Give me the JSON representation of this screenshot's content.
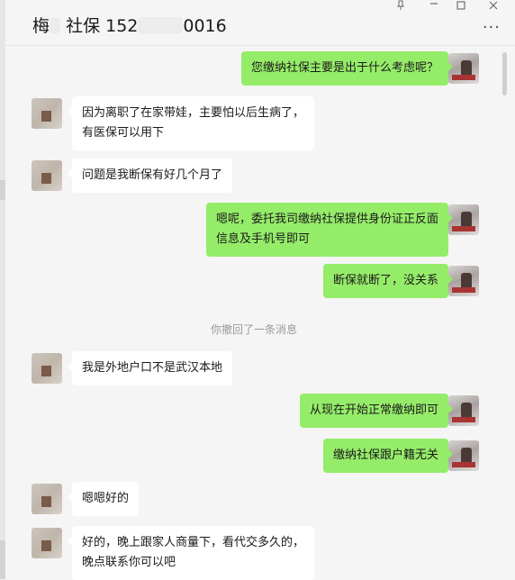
{
  "header": {
    "title_prefix": "梅",
    "title_mid": "社保 152",
    "title_suffix": "0016",
    "pin_icon": "pin-icon",
    "minimize_icon": "minimize-icon",
    "maximize_icon": "maximize-icon",
    "close_icon": "close-icon",
    "more_icon": "more-icon"
  },
  "messages": [
    {
      "side": "right",
      "text": "您缴纳社保主要是出于什么考虑呢？"
    },
    {
      "side": "left",
      "text": "因为离职了在家带娃，主要怕以后生病了，\n有医保可以用下"
    },
    {
      "side": "left",
      "text": "问题是我断保有好几个月了"
    },
    {
      "side": "right",
      "text": "嗯呢，委托我司缴纳社保提供身份证正反面\n信息及手机号即可"
    },
    {
      "side": "right",
      "text": "断保就断了，没关系"
    },
    {
      "side": "system",
      "text": "你撤回了一条消息"
    },
    {
      "side": "left",
      "text": "我是外地户口不是武汉本地"
    },
    {
      "side": "right",
      "text": "从现在开始正常缴纳即可"
    },
    {
      "side": "right",
      "text": "缴纳社保跟户籍无关"
    },
    {
      "side": "left",
      "text": "嗯嗯好的"
    },
    {
      "side": "left",
      "text": "好的，晚上跟家人商量下，看代交多久的，\n晚点联系你可以吧"
    }
  ]
}
